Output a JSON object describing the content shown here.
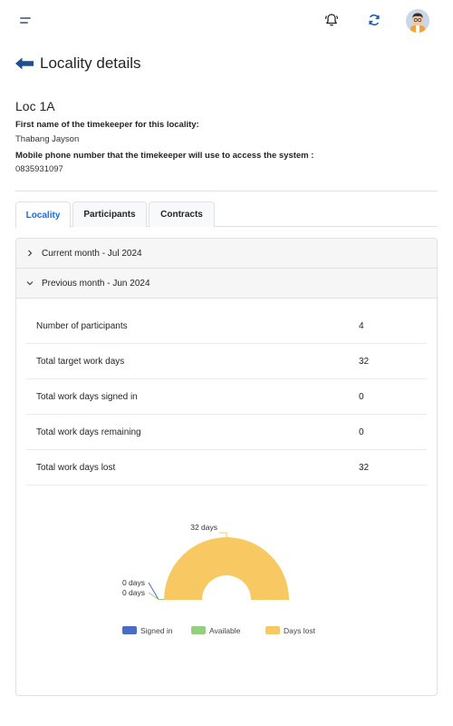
{
  "page": {
    "title": "Locality details"
  },
  "locality": {
    "name": "Loc 1A",
    "timekeeper_label": "First name of the timekeeper for this locality:",
    "timekeeper_value": "Thabang Jayson",
    "phone_label": "Mobile phone number that the timekeeper will use to access the system :",
    "phone_value": "0835931097"
  },
  "tabs": [
    {
      "label": "Locality",
      "active": true
    },
    {
      "label": "Participants",
      "active": false
    },
    {
      "label": "Contracts",
      "active": false
    }
  ],
  "accordion": [
    {
      "label": "Current month - Jul 2024",
      "expanded": false
    },
    {
      "label": "Previous month - Jun 2024",
      "expanded": true
    }
  ],
  "stats": [
    {
      "label": "Number of participants",
      "value": "4"
    },
    {
      "label": "Total target work days",
      "value": "32"
    },
    {
      "label": "Total work days signed in",
      "value": "0"
    },
    {
      "label": "Total work days remaining",
      "value": "0"
    },
    {
      "label": "Total work days lost",
      "value": "32"
    }
  ],
  "icons": {
    "menu": "menu-icon",
    "bell": "bell-icon",
    "refresh": "refresh-icon",
    "back": "arrow-left-icon"
  },
  "colors": {
    "accent": "#0d6efd",
    "signed_in": "#4a6cc7",
    "available": "#93d07e",
    "days_lost": "#f8c962"
  },
  "chart_data": {
    "type": "pie",
    "style": "half-doughnut",
    "categories": [
      "Signed in",
      "Available",
      "Days lost"
    ],
    "values": [
      0,
      0,
      32
    ],
    "data_labels": [
      "0 days",
      "0 days",
      "32 days"
    ],
    "legend": "bottom"
  }
}
